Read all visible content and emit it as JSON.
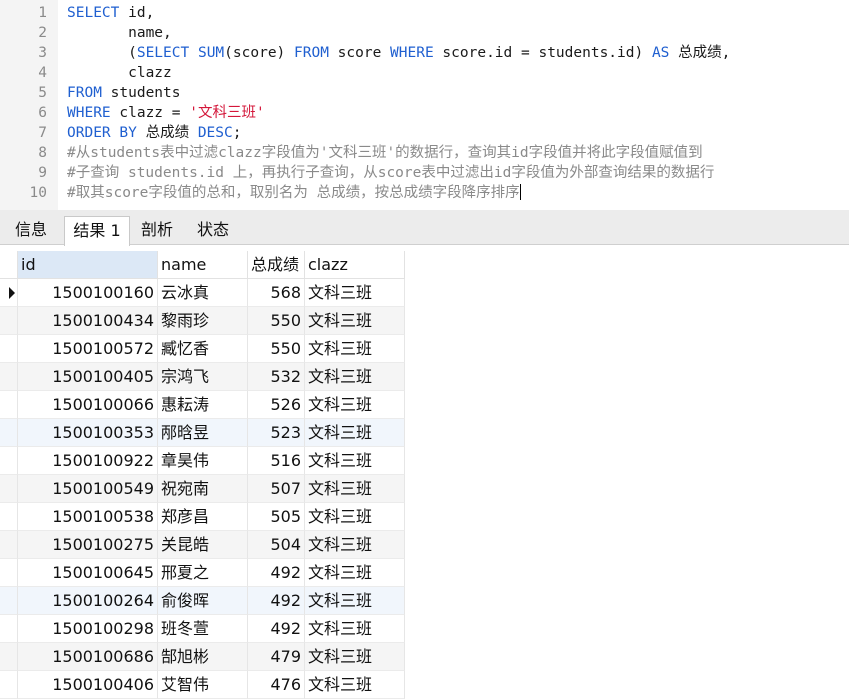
{
  "editor": {
    "lines": [
      {
        "n": "1",
        "tokens": [
          [
            "kw",
            "SELECT"
          ],
          [
            "id",
            " id,"
          ]
        ]
      },
      {
        "n": "2",
        "tokens": [
          [
            "id",
            "       name,"
          ]
        ]
      },
      {
        "n": "3",
        "tokens": [
          [
            "id",
            "       ("
          ],
          [
            "kw",
            "SELECT"
          ],
          [
            "id",
            " "
          ],
          [
            "kw",
            "SUM"
          ],
          [
            "id",
            "(score) "
          ],
          [
            "kw",
            "FROM"
          ],
          [
            "id",
            " score "
          ],
          [
            "kw",
            "WHERE"
          ],
          [
            "id",
            " score.id = students.id) "
          ],
          [
            "kw",
            "AS"
          ],
          [
            "id",
            " 总成绩,"
          ]
        ]
      },
      {
        "n": "4",
        "tokens": [
          [
            "id",
            "       clazz"
          ]
        ]
      },
      {
        "n": "5",
        "tokens": [
          [
            "kw",
            "FROM"
          ],
          [
            "id",
            " students"
          ]
        ]
      },
      {
        "n": "6",
        "tokens": [
          [
            "kw",
            "WHERE"
          ],
          [
            "id",
            " clazz = "
          ],
          [
            "str",
            "'文科三班'"
          ]
        ]
      },
      {
        "n": "7",
        "tokens": [
          [
            "kw",
            "ORDER BY"
          ],
          [
            "id",
            " 总成绩 "
          ],
          [
            "kw",
            "DESC"
          ],
          [
            "id",
            ";"
          ]
        ]
      },
      {
        "n": "8",
        "tokens": [
          [
            "cm",
            "#从students表中过滤clazz字段值为'文科三班'的数据行，查询其id字段值并将此字段值赋值到"
          ]
        ]
      },
      {
        "n": "9",
        "tokens": [
          [
            "cm",
            "#子查询 students.id 上，再执行子查询，从score表中过滤出id字段值为外部查询结果的数据行"
          ]
        ]
      },
      {
        "n": "10",
        "tokens": [
          [
            "cm",
            "#取其score字段值的总和，取别名为 总成绩，按总成绩字段降序排序"
          ]
        ]
      }
    ]
  },
  "tabs": [
    {
      "label": "信息",
      "active": false
    },
    {
      "label": "结果 1",
      "active": true
    },
    {
      "label": "剖析",
      "active": false
    },
    {
      "label": "状态",
      "active": false
    }
  ],
  "grid": {
    "headers": {
      "id": "id",
      "name": "name",
      "score": "总成绩",
      "clazz": "clazz"
    },
    "rows": [
      {
        "id": "1500100160",
        "name": "云冰真",
        "score": "568",
        "clazz": "文科三班"
      },
      {
        "id": "1500100434",
        "name": "黎雨珍",
        "score": "550",
        "clazz": "文科三班"
      },
      {
        "id": "1500100572",
        "name": "臧忆香",
        "score": "550",
        "clazz": "文科三班"
      },
      {
        "id": "1500100405",
        "name": "宗鸿飞",
        "score": "532",
        "clazz": "文科三班"
      },
      {
        "id": "1500100066",
        "name": "惠耘涛",
        "score": "526",
        "clazz": "文科三班"
      },
      {
        "id": "1500100353",
        "name": "邴晗昱",
        "score": "523",
        "clazz": "文科三班"
      },
      {
        "id": "1500100922",
        "name": "章昊伟",
        "score": "516",
        "clazz": "文科三班"
      },
      {
        "id": "1500100549",
        "name": "祝宛南",
        "score": "507",
        "clazz": "文科三班"
      },
      {
        "id": "1500100538",
        "name": "郑彦昌",
        "score": "505",
        "clazz": "文科三班"
      },
      {
        "id": "1500100275",
        "name": "关昆皓",
        "score": "504",
        "clazz": "文科三班"
      },
      {
        "id": "1500100645",
        "name": "邢夏之",
        "score": "492",
        "clazz": "文科三班"
      },
      {
        "id": "1500100264",
        "name": "俞俊晖",
        "score": "492",
        "clazz": "文科三班"
      },
      {
        "id": "1500100298",
        "name": "班冬萱",
        "score": "492",
        "clazz": "文科三班"
      },
      {
        "id": "1500100686",
        "name": "郜旭彬",
        "score": "479",
        "clazz": "文科三班"
      },
      {
        "id": "1500100406",
        "name": "艾智伟",
        "score": "476",
        "clazz": "文科三班"
      }
    ]
  }
}
